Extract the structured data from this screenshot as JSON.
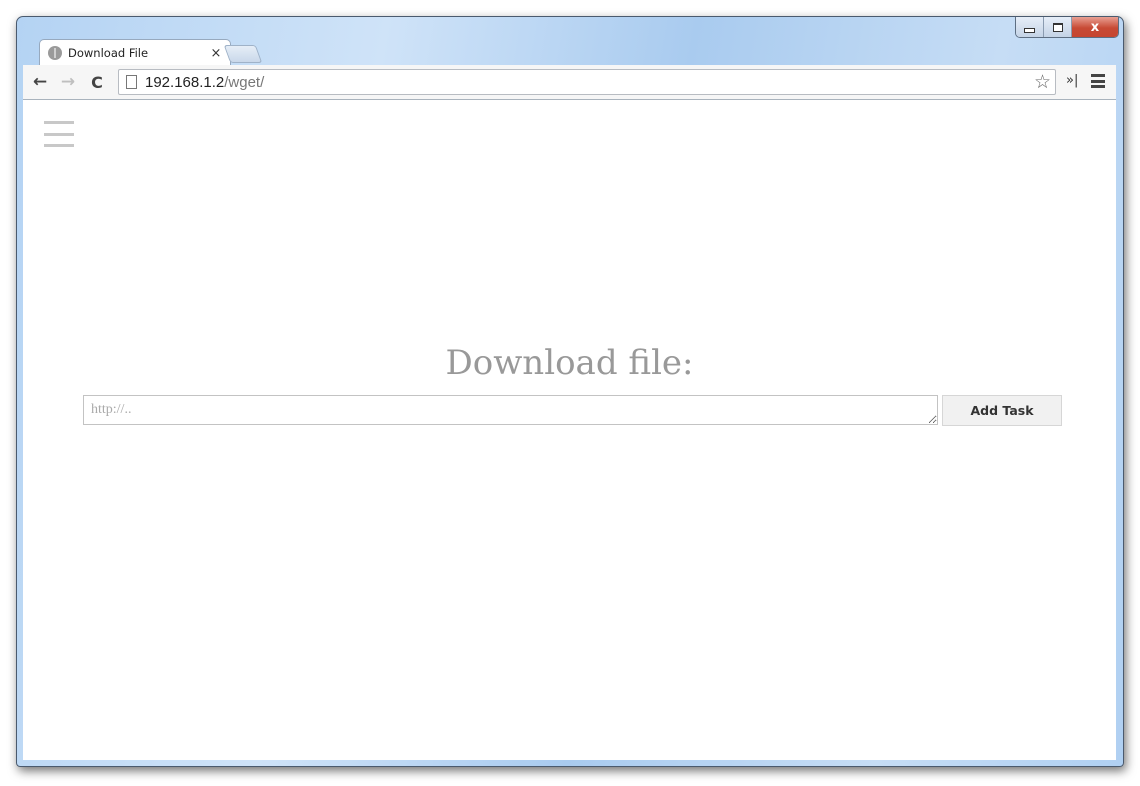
{
  "browser": {
    "tab": {
      "title": "Download File",
      "close_glyph": "×",
      "favicon": "globe-icon"
    },
    "window_controls": {
      "minimize": "minimize-icon",
      "maximize": "maximize-icon",
      "close": "x"
    },
    "nav": {
      "back": "←",
      "forward": "→",
      "reload": "C"
    },
    "address": {
      "host": "192.168.1.2",
      "path": "/wget/"
    },
    "star": "☆",
    "extensions": "»|"
  },
  "page": {
    "heading": "Download file:",
    "url_input": {
      "placeholder": "http://..",
      "value": ""
    },
    "add_button": "Add Task"
  }
}
